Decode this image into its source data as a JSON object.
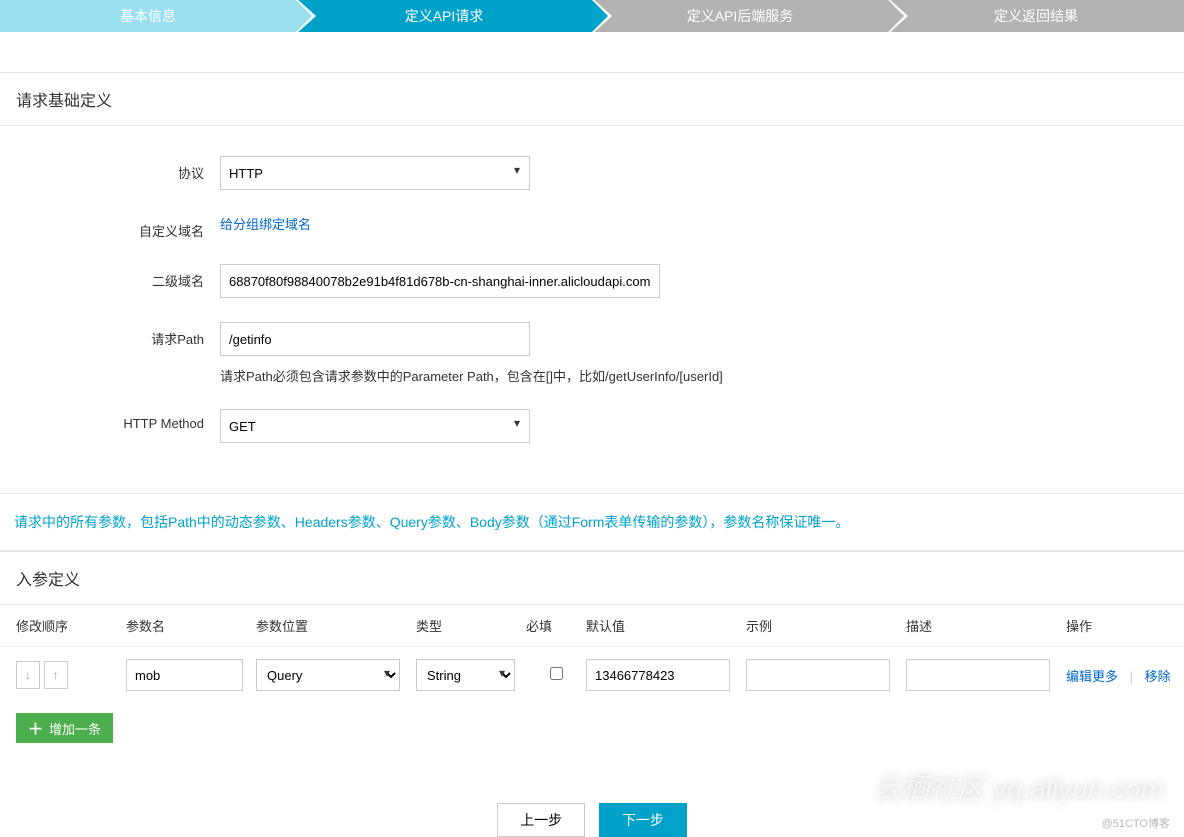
{
  "steps": [
    {
      "label": "基本信息",
      "state": "completed"
    },
    {
      "label": "定义API请求",
      "state": "active"
    },
    {
      "label": "定义API后端服务",
      "state": "pending"
    },
    {
      "label": "定义返回结果",
      "state": "pending"
    }
  ],
  "section1_title": "请求基础定义",
  "form": {
    "protocol_label": "协议",
    "protocol_value": "HTTP",
    "custom_domain_label": "自定义域名",
    "custom_domain_link": "给分组绑定域名",
    "sub_domain_label": "二级域名",
    "sub_domain_value": "68870f80f98840078b2e91b4f81d678b-cn-shanghai-inner.alicloudapi.com",
    "path_label": "请求Path",
    "path_value": "/getinfo",
    "path_hint": "请求Path必须包含请求参数中的Parameter Path，包含在[]中，比如/getUserInfo/[userId]",
    "method_label": "HTTP Method",
    "method_value": "GET"
  },
  "info_banner": "请求中的所有参数，包括Path中的动态参数、Headers参数、Query参数、Body参数（通过Form表单传输的参数），参数名称保证唯一。",
  "section2_title": "入参定义",
  "param_columns": {
    "order": "修改顺序",
    "name": "参数名",
    "position": "参数位置",
    "type": "类型",
    "required": "必填",
    "default": "默认值",
    "example": "示例",
    "description": "描述",
    "action": "操作"
  },
  "param_row": {
    "name": "mob",
    "position": "Query",
    "type": "String",
    "required": false,
    "default": "13466778423",
    "example": "",
    "description": "",
    "edit_more": "编辑更多",
    "remove": "移除"
  },
  "add_button": "增加一条",
  "footer": {
    "prev": "上一步",
    "next": "下一步"
  },
  "watermark_main": "云栖社区 yq.aliyun.com",
  "watermark_small": "@51CTO博客"
}
